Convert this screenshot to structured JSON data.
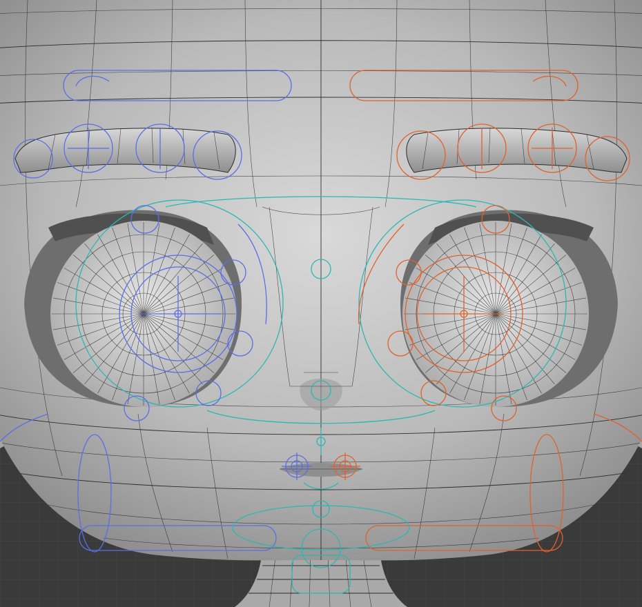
{
  "viewport": {
    "background_color": "#3a3a3a",
    "grid_color": "#474747",
    "mesh_color": "#c9c9c9",
    "wire_color": "#151515"
  },
  "controls": {
    "left_color": "#5b6ee6",
    "right_color": "#e0622a",
    "center_color": "#2bb7b3"
  }
}
